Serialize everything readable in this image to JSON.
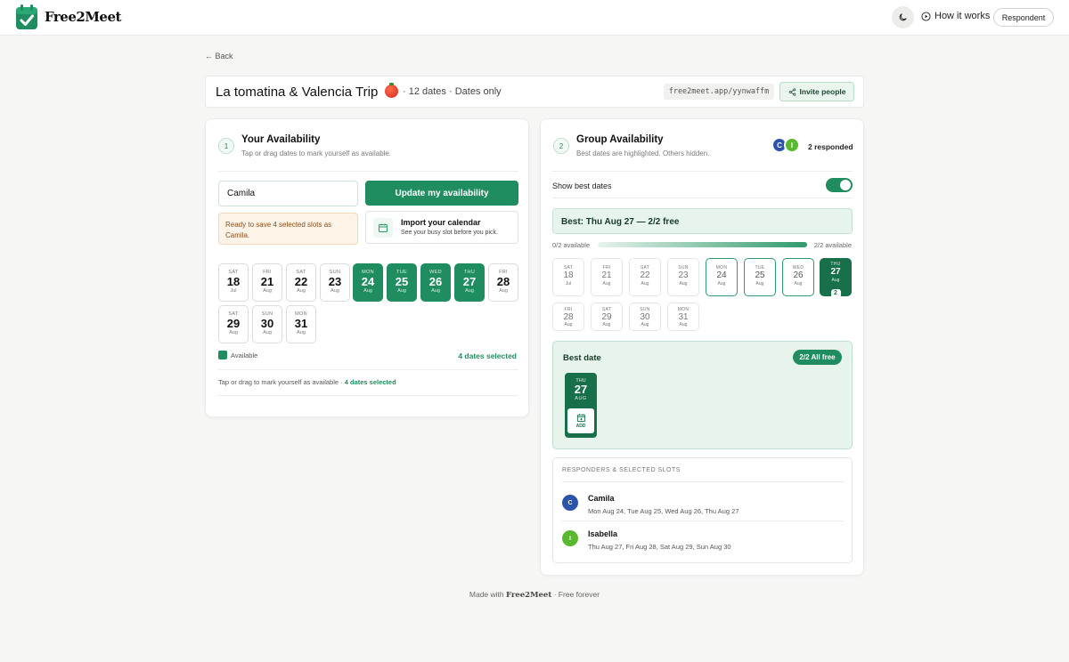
{
  "app": {
    "name": "Free2Meet",
    "brand_color": "#1f8d5f"
  },
  "header": {
    "how_it_works": "How it works",
    "role": "Respondent"
  },
  "nav": {
    "back": "← Back"
  },
  "event": {
    "title": "La tomatina & Valencia Trip",
    "meta": "· 12 dates · Dates only",
    "share_url": "free2meet.app/yynwaffm",
    "invite_label": "Invite people"
  },
  "your_availability": {
    "step": "1",
    "title": "Your Availability",
    "subtitle": "Tap or drag dates to mark yourself as available.",
    "name_value": "Camila",
    "name_placeholder": "Your name",
    "update_label": "Update my availability",
    "notice": "Ready to save 4 selected slots as Camila.",
    "import_title": "Import your calendar",
    "import_sub": "See your busy slot before you pick.",
    "dates": [
      {
        "dow": "SAT",
        "day": "18",
        "mon": "Jul",
        "selected": false
      },
      {
        "dow": "FRI",
        "day": "21",
        "mon": "Aug",
        "selected": false
      },
      {
        "dow": "SAT",
        "day": "22",
        "mon": "Aug",
        "selected": false
      },
      {
        "dow": "SUN",
        "day": "23",
        "mon": "Aug",
        "selected": false
      },
      {
        "dow": "MON",
        "day": "24",
        "mon": "Aug",
        "selected": true
      },
      {
        "dow": "TUE",
        "day": "25",
        "mon": "Aug",
        "selected": true
      },
      {
        "dow": "WED",
        "day": "26",
        "mon": "Aug",
        "selected": true
      },
      {
        "dow": "THU",
        "day": "27",
        "mon": "Aug",
        "selected": true
      },
      {
        "dow": "FRI",
        "day": "28",
        "mon": "Aug",
        "selected": false
      },
      {
        "dow": "SAT",
        "day": "29",
        "mon": "Aug",
        "selected": false
      },
      {
        "dow": "SUN",
        "day": "30",
        "mon": "Aug",
        "selected": false
      },
      {
        "dow": "MON",
        "day": "31",
        "mon": "Aug",
        "selected": false
      }
    ],
    "legend_label": "Available",
    "selected_count": "4 dates selected",
    "hint_prefix": "Tap or drag to mark yourself as available · ",
    "hint_count": "4 dates selected"
  },
  "group_availability": {
    "step": "2",
    "title": "Group Availability",
    "subtitle": "Best dates are highlighted. Others hidden.",
    "avatars": [
      "C",
      "I"
    ],
    "responded": "2 responded",
    "toggle_label": "Show best dates",
    "toggle_on": true,
    "best_banner": "Best: Thu Aug 27 — 2/2 free",
    "range_min": "0/2 available",
    "range_max": "2/2 available",
    "dates": [
      {
        "dow": "SAT",
        "day": "18",
        "mon": "Jul",
        "state": "none"
      },
      {
        "dow": "FRI",
        "day": "21",
        "mon": "Aug",
        "state": "none"
      },
      {
        "dow": "SAT",
        "day": "22",
        "mon": "Aug",
        "state": "none"
      },
      {
        "dow": "SUN",
        "day": "23",
        "mon": "Aug",
        "state": "none"
      },
      {
        "dow": "MON",
        "day": "24",
        "mon": "Aug",
        "state": "partial"
      },
      {
        "dow": "TUE",
        "day": "25",
        "mon": "Aug",
        "state": "partial"
      },
      {
        "dow": "WED",
        "day": "26",
        "mon": "Aug",
        "state": "partial"
      },
      {
        "dow": "THU",
        "day": "27",
        "mon": "Aug",
        "state": "best",
        "count": "2"
      },
      {
        "dow": "FRI",
        "day": "28",
        "mon": "Aug",
        "state": "none"
      },
      {
        "dow": "SAT",
        "day": "29",
        "mon": "Aug",
        "state": "none"
      },
      {
        "dow": "SUN",
        "day": "30",
        "mon": "Aug",
        "state": "none"
      },
      {
        "dow": "MON",
        "day": "31",
        "mon": "Aug",
        "state": "none"
      }
    ],
    "best_date": {
      "title": "Best date",
      "badge": "2/2 All free",
      "dow": "THU",
      "day": "27",
      "mon": "AUG",
      "add_label": "ADD"
    },
    "responders_heading": "RESPONDERS & SELECTED SLOTS",
    "responders": [
      {
        "initial": "C",
        "name": "Camila",
        "slots": "Mon Aug 24, Tue Aug 25, Wed Aug 26, Thu Aug 27",
        "color": "#2c53a8"
      },
      {
        "initial": "I",
        "name": "Isabella",
        "slots": "Thu Aug 27, Fri Aug 28, Sat Aug 29, Sun Aug 30",
        "color": "#59b82e"
      }
    ]
  },
  "footer": {
    "prefix": "Made with ",
    "brand": "Free2Meet",
    "suffix": " · Free forever"
  }
}
